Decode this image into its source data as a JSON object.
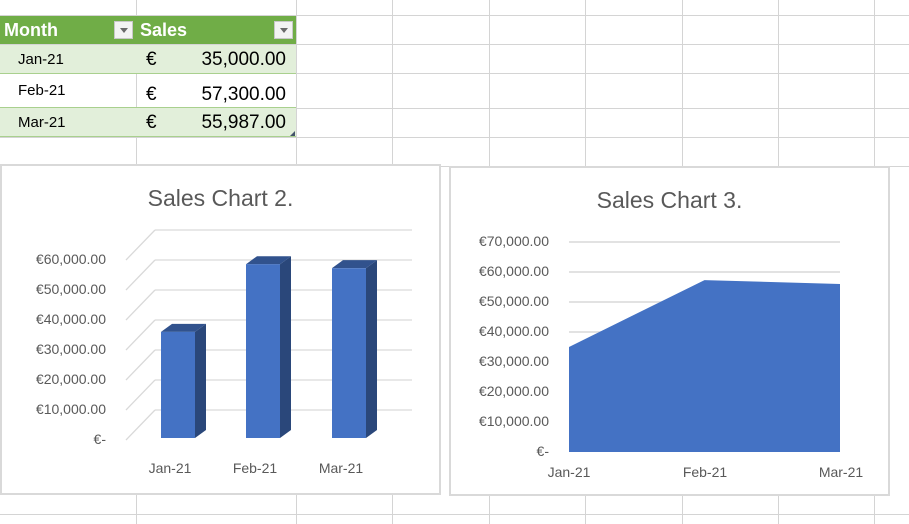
{
  "table": {
    "headers": [
      {
        "label": "Month",
        "filter": "filter-dropdown"
      },
      {
        "label": "Sales",
        "filter": "filter-dropdown"
      }
    ],
    "rows": [
      {
        "month": "Jan-21",
        "currency": "€",
        "amount": "35,000.00"
      },
      {
        "month": "Feb-21",
        "currency": "€",
        "amount": "57,300.00"
      },
      {
        "month": "Mar-21",
        "currency": "€",
        "amount": "55,987.00"
      }
    ],
    "header_color": "#70ad47",
    "band_color": "#e2efda"
  },
  "chart_data": [
    {
      "type": "bar",
      "style": "3d-column",
      "title": "Sales Chart 2.",
      "categories": [
        "Jan-21",
        "Feb-21",
        "Mar-21"
      ],
      "values": [
        35000,
        57300,
        55987
      ],
      "ylim": [
        0,
        60000
      ],
      "yticks": [
        0,
        10000,
        20000,
        30000,
        40000,
        50000,
        60000
      ],
      "ytick_labels": [
        "€-",
        "€10,000.00",
        "€20,000.00",
        "€30,000.00",
        "€40,000.00",
        "€50,000.00",
        "€60,000.00"
      ],
      "xlabel": "",
      "ylabel": "",
      "grid": true,
      "color": "#4472c4"
    },
    {
      "type": "area",
      "title": "Sales Chart 3.",
      "categories": [
        "Jan-21",
        "Feb-21",
        "Mar-21"
      ],
      "values": [
        35000,
        57300,
        55987
      ],
      "ylim": [
        0,
        70000
      ],
      "yticks": [
        0,
        10000,
        20000,
        30000,
        40000,
        50000,
        60000,
        70000
      ],
      "ytick_labels": [
        "€-",
        "€10,000.00",
        "€20,000.00",
        "€30,000.00",
        "€40,000.00",
        "€50,000.00",
        "€60,000.00",
        "€70,000.00"
      ],
      "xlabel": "",
      "ylabel": "",
      "grid": true,
      "color": "#4472c4"
    }
  ]
}
